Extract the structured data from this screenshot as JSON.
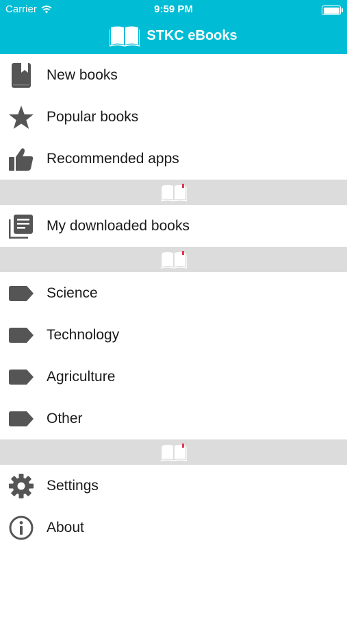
{
  "status_bar": {
    "carrier": "Carrier",
    "time": "9:59 PM"
  },
  "header": {
    "title": "STKC eBooks",
    "bg_color": "#00bcd4"
  },
  "menu": {
    "group1": [
      {
        "label": "New books",
        "icon": "bookmark-book-icon"
      },
      {
        "label": "Popular books",
        "icon": "star-icon"
      },
      {
        "label": "Recommended apps",
        "icon": "thumbs-up-icon"
      }
    ],
    "group2": [
      {
        "label": "My downloaded books",
        "icon": "library-icon"
      }
    ],
    "categories": [
      {
        "label": "Science",
        "icon": "tag-icon"
      },
      {
        "label": "Technology",
        "icon": "tag-icon"
      },
      {
        "label": "Agriculture",
        "icon": "tag-icon"
      },
      {
        "label": "Other",
        "icon": "tag-icon"
      }
    ],
    "group4": [
      {
        "label": "Settings",
        "icon": "gear-icon"
      },
      {
        "label": "About",
        "icon": "info-icon"
      }
    ]
  },
  "colors": {
    "icon": "#555555",
    "separator": "#dcdcdc",
    "text": "#1a1a1a"
  }
}
